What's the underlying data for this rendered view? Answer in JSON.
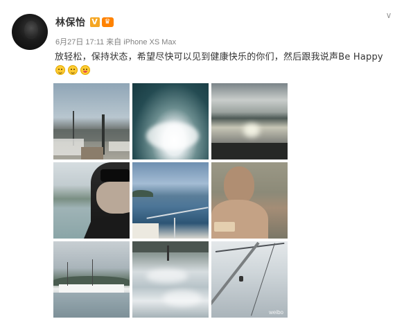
{
  "post": {
    "author": "林保怡",
    "verified_badge": "V",
    "member_badge": "♛",
    "date": "6月27日 17:11",
    "source_prefix": "来自",
    "device": "iPhone XS Max",
    "text": "放轻松，保持状态，希望尽快可以见到健康快乐的你们，然后跟我说声Be Happy",
    "emojis": [
      "grin-emoji",
      "grin-emoji",
      "tongue-emoji"
    ],
    "watermark": "weibo",
    "photos": [
      {
        "name": "marina-docks-photo"
      },
      {
        "name": "wave-spray-photo"
      },
      {
        "name": "sunset-lake-photo"
      },
      {
        "name": "selfie-sea-photo"
      },
      {
        "name": "boat-deck-photo"
      },
      {
        "name": "shirtless-selfie-photo"
      },
      {
        "name": "harbor-yachts-photo"
      },
      {
        "name": "sky-reflection-photo"
      },
      {
        "name": "mast-sky-photo"
      }
    ]
  },
  "icons": {
    "more": "chevron-down-icon"
  },
  "colors": {
    "verified": "#f5a623",
    "member": "#ff8200",
    "meta_text": "#808080",
    "body_text": "#333333"
  }
}
